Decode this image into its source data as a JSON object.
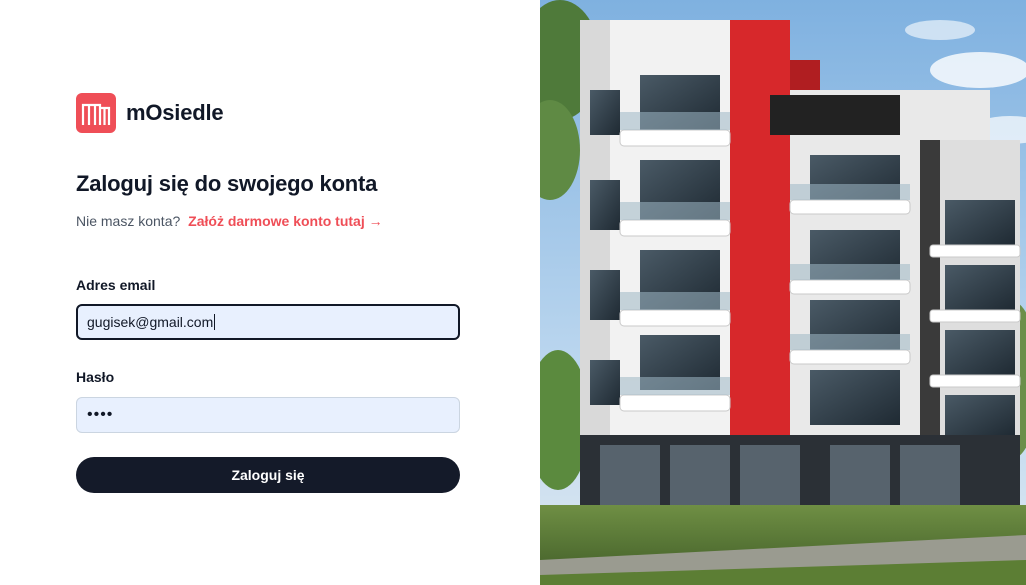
{
  "brand": {
    "name": "mOsiedle",
    "accent": "#ef4e57"
  },
  "login": {
    "title": "Zaloguj się do swojego konta",
    "subtitle_text": "Nie masz konta?",
    "register_link": "Załóż darmowe konto tutaj →",
    "email_label": "Adres email",
    "email_value": "gugisek@gmail.com",
    "password_label": "Hasło",
    "password_value": "••••",
    "submit_label": "Zaloguj się"
  },
  "colors": {
    "button_bg": "#141a29",
    "input_bg": "#e8f0fe",
    "link": "#ef4e57"
  }
}
